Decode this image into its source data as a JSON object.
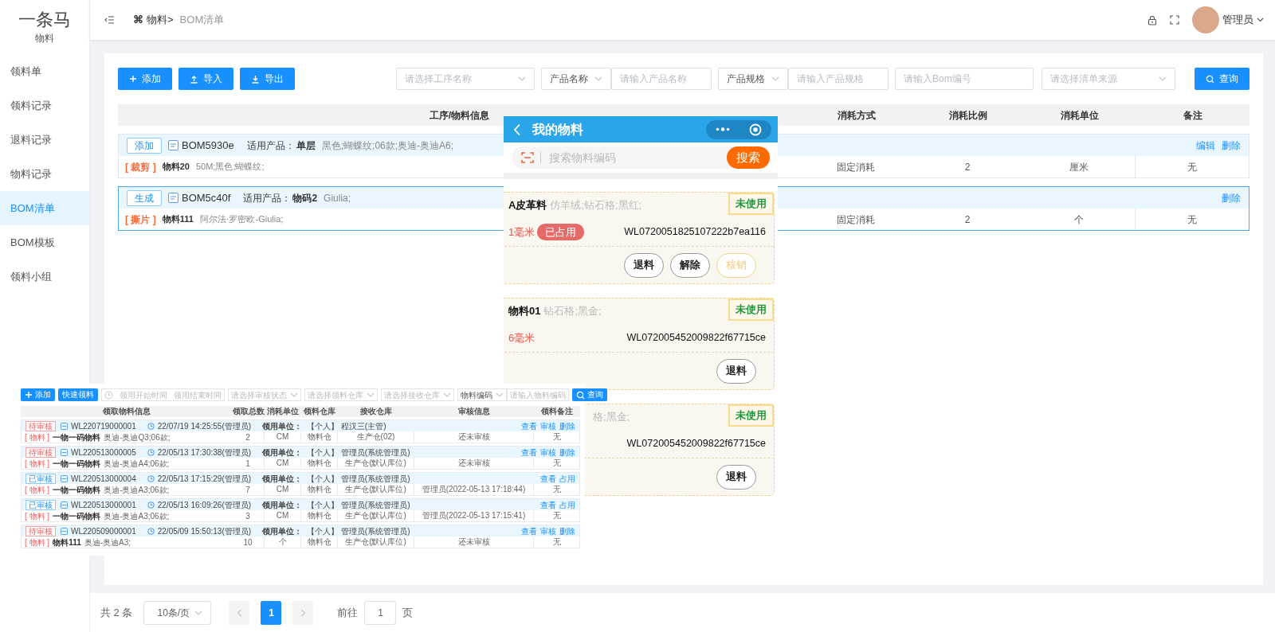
{
  "sidebar": {
    "logo": "一条马",
    "subtitle": "物料",
    "items": [
      {
        "label": "领料单",
        "selected": false
      },
      {
        "label": "领料记录",
        "selected": false
      },
      {
        "label": "退料记录",
        "selected": false
      },
      {
        "label": "物料记录",
        "selected": false
      },
      {
        "label": "BOM清单",
        "selected": true
      },
      {
        "label": "BOM模板",
        "selected": false
      },
      {
        "label": "领料小组",
        "selected": false
      }
    ]
  },
  "header": {
    "breadcrumb_icon": "⌘",
    "breadcrumb_parent": "物料>",
    "breadcrumb_current": "BOM清单",
    "user": "管理员"
  },
  "toolbar": {
    "buttons": [
      {
        "label": "添加"
      },
      {
        "label": "导入"
      },
      {
        "label": "导出"
      }
    ],
    "filters": [
      {
        "kind": "select",
        "placeholder": "请选择工序名称"
      },
      {
        "kind": "combo",
        "label": "产品名称",
        "placeholder": "请输入产品名称"
      },
      {
        "kind": "combo",
        "label": "产品规格",
        "placeholder": "请输入产品规格"
      },
      {
        "kind": "input",
        "placeholder": "请输入Bom编号"
      },
      {
        "kind": "select",
        "placeholder": "请选择清单来源"
      }
    ],
    "search_button": "查询"
  },
  "table": {
    "columns": [
      "工序/物料信息",
      "消耗方式",
      "消耗比例",
      "消耗单位",
      "备注"
    ],
    "groups": [
      {
        "tag": "添加",
        "bom_no": "BOM5930e",
        "product_label": "适用产品：",
        "product_name": "单层",
        "product_spec": "黑色;蝴蝶纹;06款;奥迪-奥迪A6;",
        "actions": [
          "编辑",
          "删除"
        ],
        "selected": false,
        "process": "[ 裁剪 ]",
        "material": "物料20",
        "material_spec": "50M;黑色;蝴蝶纹;",
        "cells": [
          "固定消耗",
          "2",
          "厘米",
          "无"
        ]
      },
      {
        "tag": "生成",
        "bom_no": "BOM5c40f",
        "product_label": "适用产品：",
        "product_name": "物码2",
        "product_spec": "Giulia;",
        "actions": [
          "删除"
        ],
        "selected": true,
        "process": "[ 撕片 ]",
        "material": "物料111",
        "material_spec": "阿尔法·罗密欧-Giulia;",
        "cells": [
          "固定消耗",
          "2",
          "个",
          "无"
        ]
      }
    ]
  },
  "pagination": {
    "total": "共 2 条",
    "page_size": "10条/页",
    "pages": [
      {
        "label": "1",
        "selected": true
      }
    ],
    "goto_label": "前往",
    "goto_value": "1",
    "goto_suffix": "页"
  },
  "mobile": {
    "title": "我的物料",
    "search_placeholder": "搜索物料编码",
    "search_button": "搜索",
    "cards": [
      {
        "name": "A皮革料",
        "spec": "仿羊绒;钻石格;黑红;",
        "covered": false,
        "status": "未使用",
        "amount": "1毫米",
        "occupied": "已占用",
        "code": "WL0720051825107222b7ea116",
        "buttons": [
          {
            "label": "退料",
            "disabled": false
          },
          {
            "label": "解除",
            "disabled": false
          },
          {
            "label": "核销",
            "disabled": true
          }
        ]
      },
      {
        "name": "物料01",
        "spec": "钻石格;黑金;",
        "covered": false,
        "status": "未使用",
        "amount": "6毫米",
        "code": "WL072005452009822f67715ce",
        "buttons": [
          {
            "label": "退料",
            "disabled": false
          }
        ]
      },
      {
        "spec": "格;黑金;",
        "covered": true,
        "status": "未使用",
        "code": "WL072005452009822f67715ce",
        "buttons": [
          {
            "label": "退料",
            "disabled": false
          }
        ]
      }
    ]
  },
  "mini": {
    "toolbar": {
      "buttons": [
        {
          "label": "添加"
        },
        {
          "label": "快速领料"
        }
      ],
      "date_start": "领用开始时间",
      "date_end": "领用结束时间",
      "filters": [
        {
          "kind": "select",
          "placeholder": "请选择审核状态"
        },
        {
          "kind": "select",
          "placeholder": "请选择领料仓库"
        },
        {
          "kind": "select",
          "placeholder": "请选择接收仓库"
        },
        {
          "kind": "combo",
          "label": "物料编码",
          "placeholder": "请输入物料编码"
        }
      ],
      "search_button": "查询"
    },
    "columns": [
      "领取物料信息",
      "领取总数",
      "消耗单位",
      "领料仓库",
      "接收仓库",
      "审核信息",
      "领料备注"
    ],
    "groups": [
      {
        "status": "待审核",
        "approved": false,
        "id": "WL220719000001",
        "time": "22/07/19 14:25:55(管理员)",
        "unit_label": "领用单位：",
        "unit": "【个人】 程汉三(主管)",
        "actions": [
          "查看",
          "审核",
          "删除"
        ],
        "tag": "[ 物料 ]",
        "material": "一物一码物料",
        "spec": "奥迪-奥迪Q3;06款;",
        "cells": [
          "2",
          "CM",
          "物料仓",
          "生产仓(02)",
          "还未审核",
          "无"
        ]
      },
      {
        "status": "待审核",
        "approved": false,
        "id": "WL220513000005",
        "time": "22/05/13 17:30:38(管理员)",
        "unit_label": "领用单位：",
        "unit": "【个人】 管理员(系统管理员)",
        "actions": [
          "查看",
          "审核",
          "删除"
        ],
        "tag": "[ 物料 ]",
        "material": "一物一码物料",
        "spec": "奥迪-奥迪A4;06款;",
        "cells": [
          "1",
          "CM",
          "物料仓",
          "生产仓(默认库位)",
          "还未审核",
          "无"
        ]
      },
      {
        "status": "已审核",
        "approved": true,
        "id": "WL220513000004",
        "time": "22/05/13 17:15:29(管理员)",
        "unit_label": "领用单位：",
        "unit": "【个人】 管理员(系统管理员)",
        "actions": [
          "查看",
          "占用"
        ],
        "tag": "[ 物料 ]",
        "material": "一物一码物料",
        "spec": "奥迪-奥迪A3;06款;",
        "cells": [
          "7",
          "CM",
          "物料仓",
          "生产仓(默认库位)",
          "管理员(2022-05-13 17:18:44)",
          "无"
        ]
      },
      {
        "status": "已审核",
        "approved": true,
        "id": "WL220513000001",
        "time": "22/05/13 16:09:26(管理员)",
        "unit_label": "领用单位：",
        "unit": "【个人】 管理员(系统管理员)",
        "actions": [
          "查看",
          "占用"
        ],
        "tag": "[ 物料 ]",
        "material": "一物一码物料",
        "spec": "奥迪-奥迪A3;06款;",
        "cells": [
          "3",
          "CM",
          "物料仓",
          "生产仓(默认库位)",
          "管理员(2022-05-13 17:15:41)",
          "无"
        ]
      },
      {
        "status": "待审核",
        "approved": false,
        "id": "WL220509000001",
        "time": "22/05/09 15:50:13(管理员)",
        "unit_label": "领用单位：",
        "unit": "【个人】 管理员(系统管理员)",
        "actions": [
          "查看",
          "审核",
          "删除"
        ],
        "tag": "[ 物料 ]",
        "material": "物料111",
        "spec": "奥迪-奥迪A3;",
        "cells": [
          "10",
          "个",
          "物料仓",
          "生产仓(默认库位)",
          "还未审核",
          "无"
        ]
      }
    ]
  }
}
